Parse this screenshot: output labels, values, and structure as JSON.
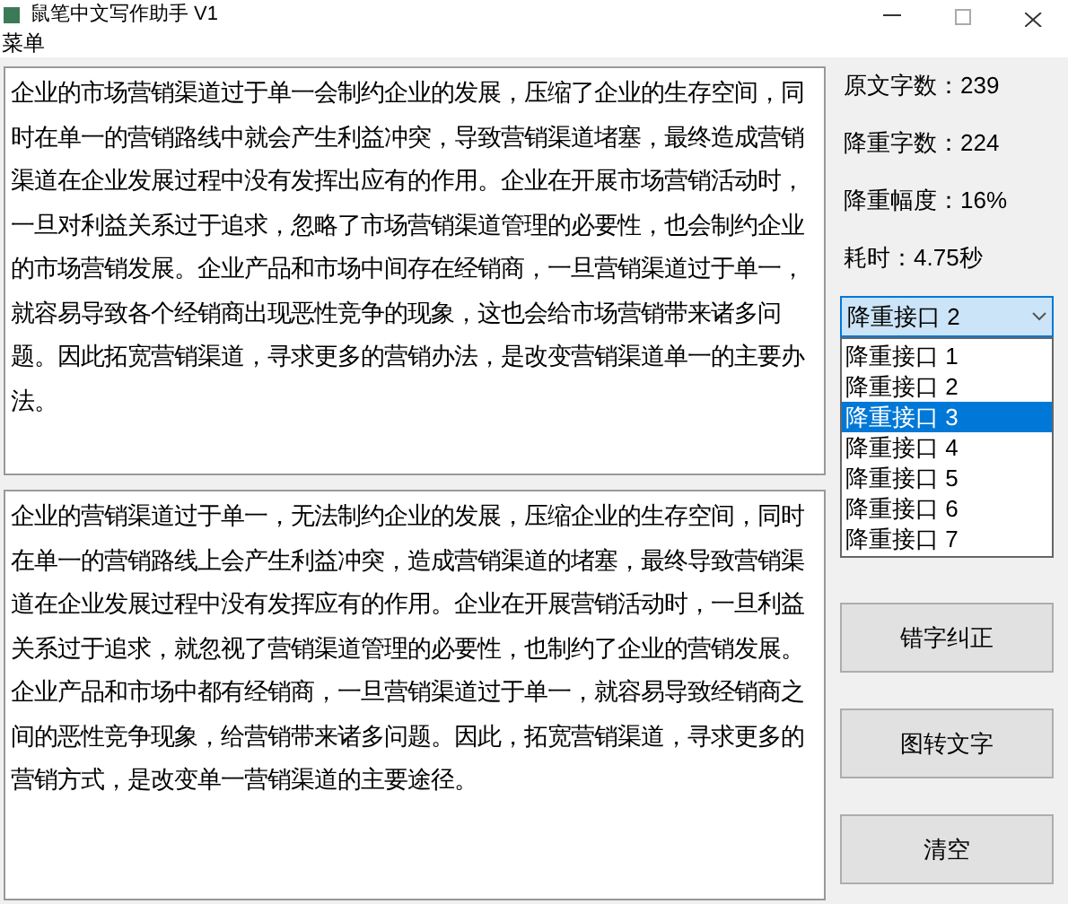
{
  "window": {
    "title": "鼠笔中文写作助手 V1"
  },
  "menu": [
    "菜单"
  ],
  "source_text": "企业的市场营销渠道过于单一会制约企业的发展，压缩了企业的生存空间，同时在单一的营销路线中就会产生利益冲突，导致营销渠道堵塞，最终造成营销渠道在企业发展过程中没有发挥出应有的作用。企业在开展市场营销活动时，一旦对利益关系过于追求，忽略了市场营销渠道管理的必要性，也会制约企业的市场营销发展。企业产品和市场中间存在经销商，一旦营销渠道过于单一，就容易导致各个经销商出现恶性竞争的现象，这也会给市场营销带来诸多问题。因此拓宽营销渠道，寻求更多的营销办法，是改变营销渠道单一的主要办法。",
  "result_text": "企业的营销渠道过于单一，无法制约企业的发展，压缩企业的生存空间，同时在单一的营销路线上会产生利益冲突，造成营销渠道的堵塞，最终导致营销渠道在企业发展过程中没有发挥应有的作用。企业在开展营销活动时，一旦利益关系过于追求，就忽视了营销渠道管理的必要性，也制约了企业的营销发展。企业产品和市场中都有经销商，一旦营销渠道过于单一，就容易导致经销商之间的恶性竞争现象，给营销带来诸多问题。因此，拓宽营销渠道，寻求更多的营销方式，是改变单一营销渠道的主要途径。",
  "stats": [
    "原文字数：239",
    "降重字数：224",
    "降重幅度：16%",
    "耗时：4.75秒"
  ],
  "select": {
    "value": "降重接口 2",
    "open": true,
    "options": [
      {
        "label": "降重接口 1",
        "highlighted": false
      },
      {
        "label": "降重接口 2",
        "highlighted": false
      },
      {
        "label": "降重接口 3",
        "highlighted": true
      },
      {
        "label": "降重接口 4",
        "highlighted": false
      },
      {
        "label": "降重接口 5",
        "highlighted": false
      },
      {
        "label": "降重接口 6",
        "highlighted": false
      },
      {
        "label": "降重接口 7",
        "highlighted": false
      }
    ]
  },
  "buttons": [
    "错字纠正",
    "图转文字",
    "清空"
  ]
}
